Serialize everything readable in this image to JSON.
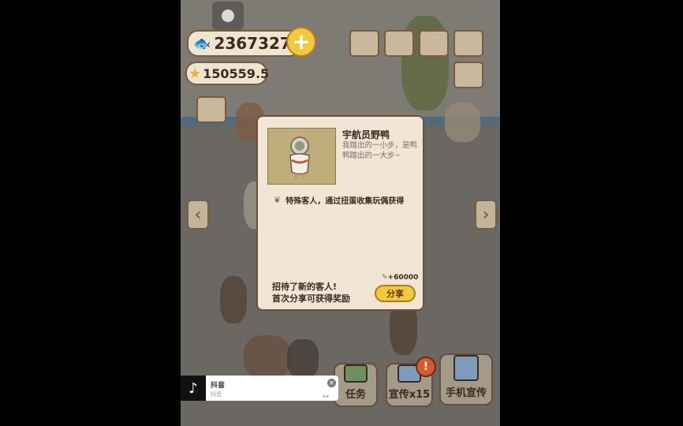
{
  "hud": {
    "fish_currency": "23673271",
    "star_currency": "150559.5"
  },
  "dialog": {
    "guest_name": "宇航员野鸭",
    "guest_desc": "我踏出的一小步，是鸭鸭踏出的一大步~",
    "info": "特殊客人，通过扭蛋收集玩偶获得",
    "reward": "+60000",
    "invite_line1": "招待了新的客人!",
    "invite_line2": "首次分享可获得奖励",
    "share_label": "分享"
  },
  "bottom_bar": {
    "tasks_label": "任务",
    "promote_label": "宣传x15",
    "phone_promote_label": "手机宣传"
  },
  "ad": {
    "app_name": "抖音",
    "sub_text": "抖音"
  }
}
